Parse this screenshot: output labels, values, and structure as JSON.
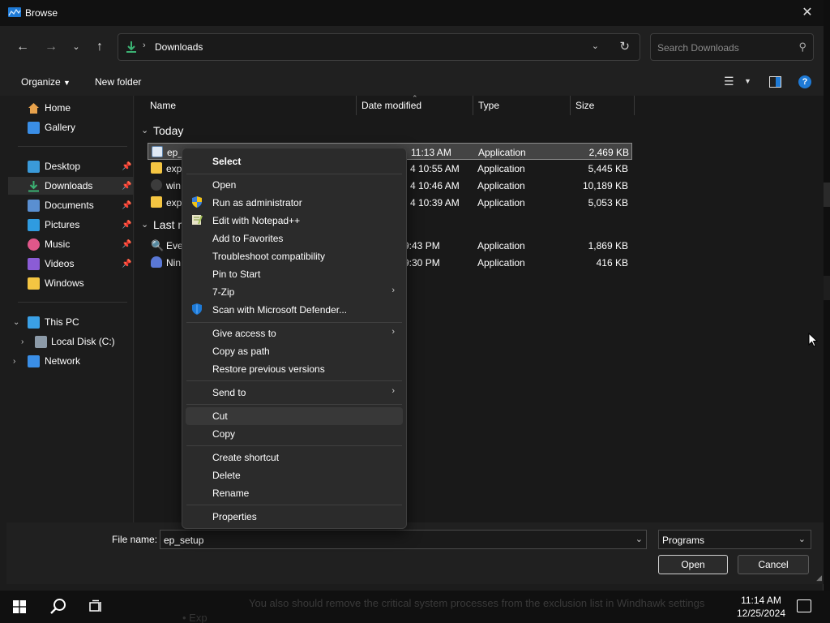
{
  "window": {
    "title": "Browse"
  },
  "address": {
    "path": "Downloads",
    "search_placeholder": "Search Downloads"
  },
  "toolbar": {
    "organize": "Organize",
    "new_folder": "New folder"
  },
  "nav_pane": {
    "items": [
      {
        "label": "Home"
      },
      {
        "label": "Gallery"
      },
      {
        "label": "Desktop"
      },
      {
        "label": "Downloads"
      },
      {
        "label": "Documents"
      },
      {
        "label": "Pictures"
      },
      {
        "label": "Music"
      },
      {
        "label": "Videos"
      },
      {
        "label": "Windows"
      },
      {
        "label": "This PC"
      },
      {
        "label": "Local Disk (C:)"
      },
      {
        "label": "Network"
      }
    ]
  },
  "columns": {
    "name": "Name",
    "date": "Date modified",
    "type": "Type",
    "size": "Size"
  },
  "groups": {
    "today": "Today",
    "last": "Last m"
  },
  "files": [
    {
      "name": "ep_",
      "date": "12/25/2024 11:13 AM",
      "date_visible": "11:13 AM",
      "type": "Application",
      "size": "2,469 KB"
    },
    {
      "name": "exp",
      "date_visible": "4 10:55 AM",
      "type": "Application",
      "size": "5,445 KB"
    },
    {
      "name": "win",
      "date_visible": "4 10:46 AM",
      "type": "Application",
      "size": "10,189 KB"
    },
    {
      "name": "exp",
      "date_visible": "4 10:39 AM",
      "type": "Application",
      "size": "5,053 KB"
    },
    {
      "name": "Eve",
      "date_visible": "9:43 PM",
      "type": "Application",
      "size": "1,869 KB"
    },
    {
      "name": "Nin",
      "date_visible": "9:30 PM",
      "type": "Application",
      "size": "416 KB"
    }
  ],
  "context_menu": {
    "select": "Select",
    "open": "Open",
    "run_admin": "Run as administrator",
    "notepad": "Edit with Notepad++",
    "favorites": "Add to Favorites",
    "troubleshoot": "Troubleshoot compatibility",
    "pin_start": "Pin to Start",
    "zip": "7-Zip",
    "defender": "Scan with Microsoft Defender...",
    "give_access": "Give access to",
    "copy_path": "Copy as path",
    "restore": "Restore previous versions",
    "send_to": "Send to",
    "cut": "Cut",
    "copy": "Copy",
    "shortcut": "Create shortcut",
    "delete": "Delete",
    "rename": "Rename",
    "properties": "Properties"
  },
  "footer": {
    "file_name_label": "File name:",
    "file_name_value": "ep_setup",
    "file_type": "Programs",
    "open": "Open",
    "cancel": "Cancel"
  },
  "taskbar": {
    "time": "11:14 AM",
    "date": "12/25/2024",
    "bg_text": "You also should remove the critical system processes from the exclusion list in Windhawk settings",
    "bg_text2": "Exp"
  },
  "colors": {
    "accent": "#1e7ad6",
    "downloads": "#3bb273",
    "folder": "#f4c542"
  }
}
